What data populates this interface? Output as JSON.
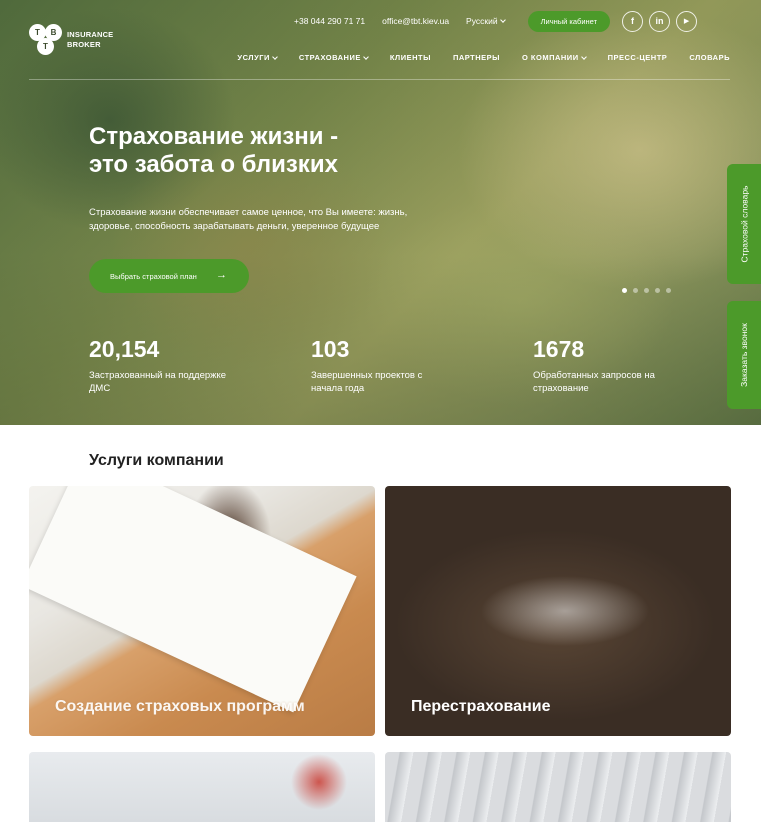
{
  "brand": {
    "logo_letters": [
      "T",
      "B",
      "T"
    ],
    "name_line1": "INSURANCE",
    "name_line2": "BROKER"
  },
  "topbar": {
    "phone": "+38 044 290 71 71",
    "email": "office@tbt.kiev.ua",
    "language": "Русский",
    "cabinet_label": "Личный кабинет",
    "social": [
      {
        "icon": "facebook-icon",
        "glyph": "f"
      },
      {
        "icon": "linkedin-icon",
        "glyph": "in"
      },
      {
        "icon": "youtube-icon",
        "glyph": "▶"
      }
    ]
  },
  "nav": {
    "items": [
      {
        "label": "УСЛУГИ",
        "dropdown": true
      },
      {
        "label": "СТРАХОВАНИЕ",
        "dropdown": true
      },
      {
        "label": "КЛИЕНТЫ",
        "dropdown": false
      },
      {
        "label": "ПАРТНЕРЫ",
        "dropdown": false
      },
      {
        "label": "О КОМПАНИИ",
        "dropdown": true
      },
      {
        "label": "ПРЕСС-ЦЕНТР",
        "dropdown": false
      },
      {
        "label": "СЛОВАРЬ",
        "dropdown": false
      }
    ]
  },
  "hero": {
    "title_line1": "Страхование жизни -",
    "title_line2": "это забота о близких",
    "subtitle": "Страхование жизни обеспечивает самое ценное, что Вы имеете: жизнь, здоровье, способность зарабатывать деньги, уверенное будущее",
    "cta_label": "Выбрать страховой план",
    "slides_total": 5,
    "active_slide": 1
  },
  "stats": [
    {
      "value": "20,154",
      "label": "Застрахованный на поддержке ДМС"
    },
    {
      "value": "103",
      "label": "Завершенных проектов с начала года"
    },
    {
      "value": "1678",
      "label": "Обработанных запросов на страхование"
    }
  ],
  "side_tabs": {
    "dictionary": "Страховой словарь",
    "callback": "Заказать звонок"
  },
  "services": {
    "title": "Услуги компании",
    "cards": [
      {
        "title": "Создание страховых программ"
      },
      {
        "title": "Перестрахование"
      },
      {
        "title": ""
      },
      {
        "title": ""
      }
    ]
  },
  "colors": {
    "accent": "#4c9a2a",
    "text_dark": "#222222",
    "white": "#ffffff"
  }
}
